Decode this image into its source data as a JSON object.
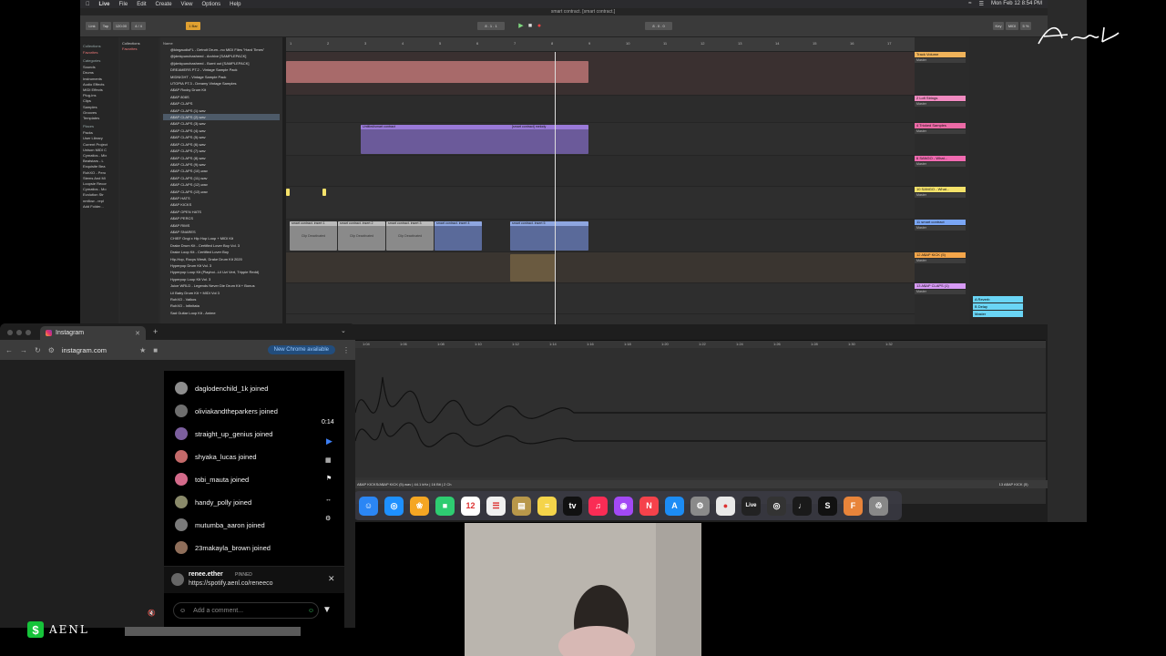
{
  "menubar": {
    "app_name": "Live",
    "items": [
      "File",
      "Edit",
      "Create",
      "View",
      "Options",
      "Help"
    ],
    "clock": "Mon Feb 12  8:54 PM"
  },
  "ableton": {
    "title": "smart contract.  [smart contract.]",
    "transport": {
      "link": "Link",
      "tap": "Tap",
      "tempo": "120.00",
      "signature": "4 / 4",
      "bar": "1 Bar",
      "position": "8 . 1 . 1",
      "loop_end": "8 . 0 . 0",
      "key": "Key",
      "midi": "MIDI",
      "cpu": "5 %"
    },
    "browser": {
      "collections_header": "Collections",
      "favorites": "Favorites",
      "categories_header": "Categories",
      "categories": [
        "Sounds",
        "Drums",
        "Instruments",
        "Audio Effects",
        "MIDI Effects",
        "Plug-ins",
        "Clips",
        "Samples",
        "Grooves",
        "Templates"
      ],
      "places_header": "Places",
      "places": [
        "Packs",
        "User Library",
        "Current Project",
        "Unison MIDI C",
        "Cymatics - Mix",
        "Beatstars - L",
        "Exquisite Bea",
        "RohXO - Pero",
        "Stems And Mi",
        "Loopsie Recor",
        "Cymatics - Mo",
        "Evolution Str",
        "nmflow - repl",
        "Add Folder..."
      ],
      "name_header": "Name",
      "files": [
        "@kingaudioFL - Detroit Drum...no MIDI Files \"Hard Times\"",
        "@jdmkpunchasheed - Archive [SAMPLEPACK]",
        "@jdmkpunchasheed - Burnt out [SAMPLEPACK]",
        "DREAMERS PT.2 - Vintage Sample Pack",
        "MIDNIGHT - Vintage Sample Pack",
        "UTOPIA PT.3 - Dreamy Vintage Samples",
        "A$AP Rocky Drum Kit",
        "A$AP 808S",
        "A$AP CLAPS",
        "A$AP CLAPS (1).wav",
        "A$AP CLAPS (2).wav",
        "A$AP CLAPS (3).wav",
        "A$AP CLAPS (4).wav",
        "A$AP CLAPS (5).wav",
        "A$AP CLAPS (6).wav",
        "A$AP CLAPS (7).wav",
        "A$AP CLAPS (8).wav",
        "A$AP CLAPS (9).wav",
        "A$AP CLAPS (10).wav",
        "A$AP CLAPS (11).wav",
        "A$AP CLAPS (12).wav",
        "A$AP CLAPS (13).wav",
        "A$AP HATS",
        "A$AP KICKS",
        "A$AP OPEN HATS",
        "A$AP PERCS",
        "A$AP RIMS",
        "A$AP SNARES",
        "CHIEF Ongi x Hip Hop Loop + MIDI Kit",
        "Drake Drum Kit - Certified Lover Boy Vol. 3",
        "Drake Loop Kit - Certified Lover Boy",
        "Hip-Hop, Rocys Westt, Drake Drum Kit 2020",
        "Hyperpop Drum Kit Vol. 3",
        "Hyperpop Loop Kit (Playboi...Lil Uzi Vert, Trippie Redd)",
        "Hyperpop Loop Kit Vol. 3",
        "Juice WRLD - Legends Never Die Drum Kit + Bonus",
        "Lil Baby Drum Kit + MIDI Vol 3",
        "RohXO - Valkos",
        "RohXO - Infinitata",
        "Sad Guitar Loop Kit - Anime"
      ],
      "selected_index": 10
    },
    "arrangement": {
      "ruler_marks": [
        "1",
        "2",
        "3",
        "4",
        "5",
        "6",
        "7",
        "8",
        "9",
        "10",
        "11",
        "12",
        "13",
        "14",
        "15",
        "16",
        "17"
      ],
      "clip_labels": {
        "clip_a": "smart contract. insert 1",
        "clip_b": "smart contract. insert 2",
        "clip_c": "smart contract. insert 3",
        "clip_d": "smart contract. insert 4",
        "clip_e": "smart contract. insert 5",
        "deactivated": "Clip Deactivated",
        "midi_clip_1": "Untitled/smart contract",
        "midi_clip_2": "[smart contract] melody"
      }
    },
    "tracks": [
      {
        "name": "Track Volume",
        "route": "Master",
        "color": "#f0b35a"
      },
      {
        "name": "2 Lofi Strings",
        "route": "Master",
        "color": "#f08ac0"
      },
      {
        "name": "4 Tricked Samples",
        "route": "Master",
        "color": "#ec6aa6"
      },
      {
        "name": "6 SANGO - What...",
        "route": "Master",
        "color": "#f06ab0"
      },
      {
        "name": "10 SANGO - What...",
        "route": "Master",
        "color": "#f5e26a"
      },
      {
        "name": "11 smart contract",
        "route": "Master",
        "color": "#7aa6f5"
      },
      {
        "name": "12 A$AP KICK (5)",
        "route": "Master",
        "color": "#f5a64a"
      },
      {
        "name": "13 A$AP CLAPS (1)",
        "route": "Master",
        "color": "#d79af5"
      }
    ],
    "returns": [
      "A Reverb",
      "B Delay",
      "Master"
    ],
    "detail": {
      "times": [
        "1:04",
        "1:06",
        "1:08",
        "1:10",
        "1:12",
        "1:14",
        "1:16",
        "1:18",
        "1:20",
        "1:22",
        "1:24",
        "1:26",
        "1:28",
        "1:30",
        "1:32"
      ],
      "bottom_times": [
        "0:00:000",
        "0:00:020",
        "0:00:040",
        "0:00:060",
        "0:00:080",
        "0:00:100",
        "0:00:120",
        "0:00:140",
        "0:00:160",
        "0:00:180",
        "0:00:200",
        "0:00:220",
        "0:00:240"
      ]
    },
    "status_left": "A$AP KICKS/A$AP KICK (5).wav | 44.1 kHz | 16 Bit | 2 Ch",
    "status_right": "13 A$AP KICK (5)"
  },
  "dock": {
    "apps": [
      {
        "name": "finder",
        "color": "#2b86f5",
        "glyph": "☺"
      },
      {
        "name": "safari",
        "color": "#1e90ff",
        "glyph": "◎"
      },
      {
        "name": "photos",
        "color": "#f5a623",
        "glyph": "❀"
      },
      {
        "name": "facetime",
        "color": "#2ecc71",
        "glyph": "■"
      },
      {
        "name": "calendar",
        "color": "#ffffff",
        "glyph": "12"
      },
      {
        "name": "reminders",
        "color": "#f0f0f0",
        "glyph": "☰"
      },
      {
        "name": "notes-gold",
        "color": "#b8974a",
        "glyph": "▤"
      },
      {
        "name": "notes",
        "color": "#f5d44a",
        "glyph": "≡"
      },
      {
        "name": "apple-tv",
        "color": "#111111",
        "glyph": "tv"
      },
      {
        "name": "music",
        "color": "#fa2c55",
        "glyph": "♫"
      },
      {
        "name": "podcasts",
        "color": "#a349f5",
        "glyph": "◉"
      },
      {
        "name": "news",
        "color": "#f5424b",
        "glyph": "N"
      },
      {
        "name": "app-store",
        "color": "#1c8cf5",
        "glyph": "A"
      },
      {
        "name": "system-settings",
        "color": "#8a8a8a",
        "glyph": "⚙"
      },
      {
        "name": "chrome",
        "color": "#e9e9e9",
        "glyph": "●"
      },
      {
        "name": "ableton-live",
        "color": "#222222",
        "glyph": "Live"
      },
      {
        "name": "logic",
        "color": "#333333",
        "glyph": "◎"
      },
      {
        "name": "piano",
        "color": "#1a1a1a",
        "glyph": "♩"
      },
      {
        "name": "splice",
        "color": "#111111",
        "glyph": "S"
      },
      {
        "name": "fl-studio",
        "color": "#e8843a",
        "glyph": "F"
      },
      {
        "name": "trash",
        "color": "#888888",
        "glyph": "♲"
      }
    ],
    "calendar_date": "12"
  },
  "chrome": {
    "tab_title": "Instagram",
    "url": "instagram.com",
    "update_pill": "New Chrome available"
  },
  "instagram": {
    "joined": [
      "daglodenchild_1k joined",
      "oliviakandtheparkers joined",
      "straight_up_genius joined",
      "shyaka_lucas joined",
      "tobi_mauta joined",
      "handy_polly joined",
      "mutumba_aaron joined",
      "23makayla_brown joined"
    ],
    "timer": "0:14",
    "pinned": {
      "user": "renee.ether",
      "badge": "PINNED",
      "link": "https://spotify.aenl.co/reneeco"
    },
    "comment_placeholder": "Add a comment..."
  },
  "brand": {
    "signature": "Aenl",
    "corner_text": "AENL",
    "money_glyph": "$"
  }
}
